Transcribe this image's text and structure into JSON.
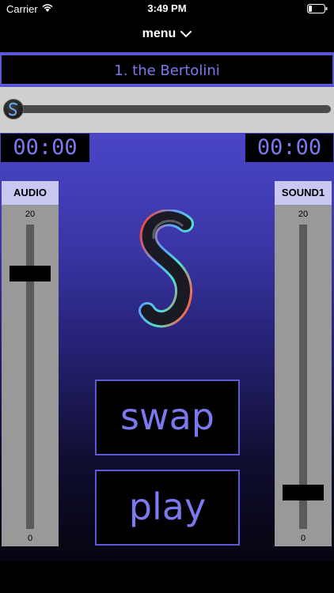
{
  "status_bar": {
    "carrier": "Carrier",
    "time": "3:49 PM"
  },
  "menu": {
    "label": "menu",
    "icon": "chevron-down-icon"
  },
  "track": {
    "title": "1. the Bertolini",
    "progress": 0.0
  },
  "timers": {
    "elapsed": "00:00",
    "remaining": "00:00"
  },
  "faders": {
    "audio": {
      "label": "AUDIO",
      "max": "20",
      "min": "0",
      "value_fraction": 0.84
    },
    "sound1": {
      "label": "SOUND1",
      "max": "20",
      "min": "0",
      "value_fraction": 0.12
    }
  },
  "buttons": {
    "swap": "swap",
    "play": "play"
  },
  "colors": {
    "accent": "#7c78ee",
    "border": "#5d58d8",
    "label_bg": "#c9c8f2"
  }
}
